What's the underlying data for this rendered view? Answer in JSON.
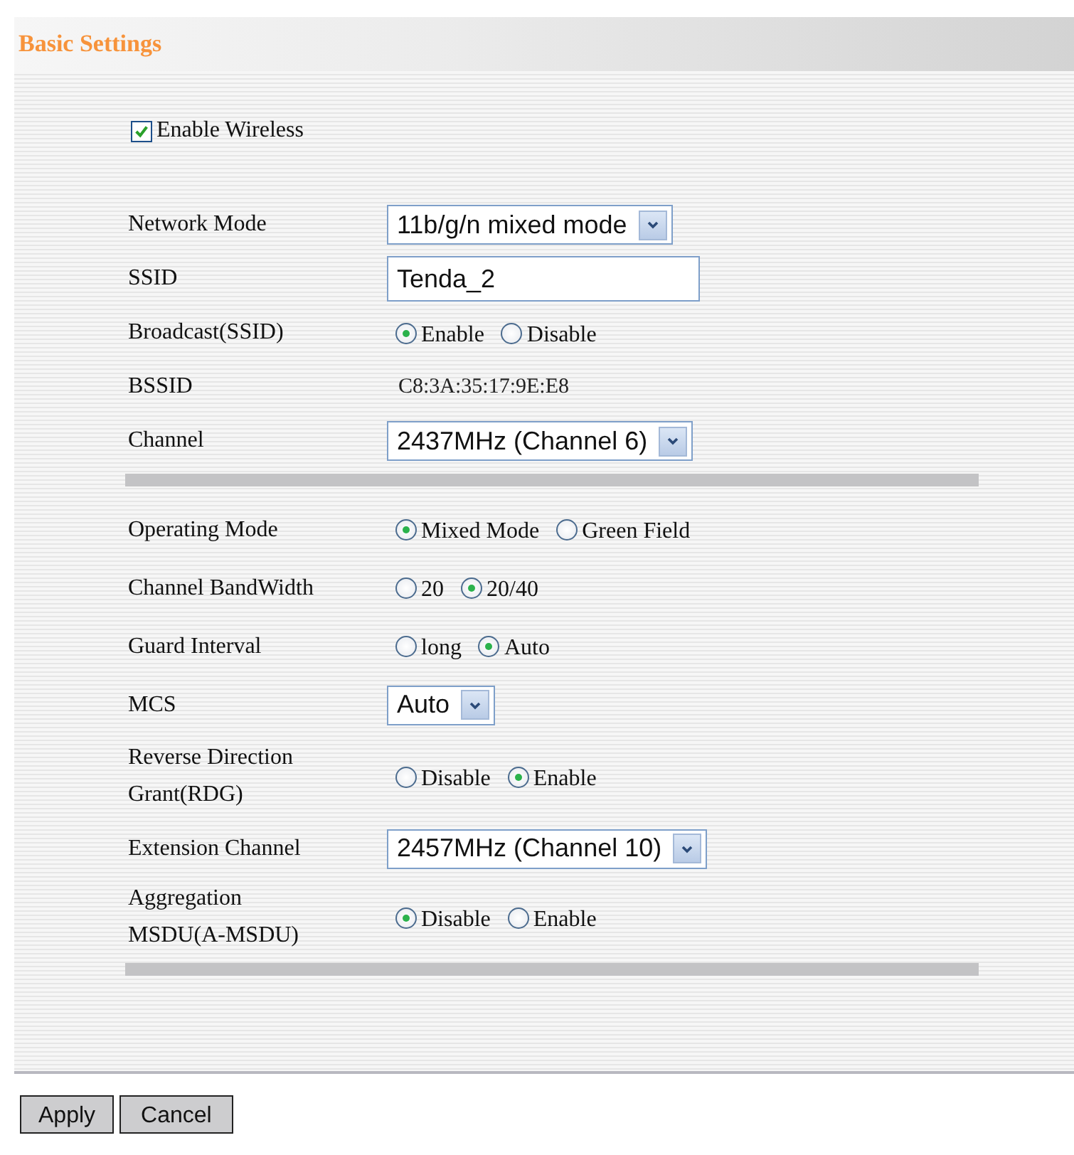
{
  "title": "Basic Settings",
  "enable_wireless": {
    "label": "Enable Wireless",
    "checked": true
  },
  "sections": [
    {
      "rows": [
        {
          "label": "Network Mode",
          "kind": "select",
          "value": "11b/g/n mixed mode"
        },
        {
          "label": "SSID",
          "kind": "input",
          "value": "Tenda_2"
        },
        {
          "label": "Broadcast(SSID)",
          "kind": "radio",
          "options": [
            {
              "label": "Enable",
              "selected": true
            },
            {
              "label": "Disable",
              "selected": false
            }
          ]
        },
        {
          "label": "BSSID",
          "kind": "static",
          "value": "C8:3A:35:17:9E:E8"
        },
        {
          "label": "Channel",
          "kind": "select",
          "value": "2437MHz (Channel 6)"
        }
      ]
    },
    {
      "rows": [
        {
          "label": "Operating Mode",
          "kind": "radio",
          "options": [
            {
              "label": "Mixed Mode",
              "selected": true
            },
            {
              "label": "Green Field",
              "selected": false
            }
          ]
        },
        {
          "label": "Channel BandWidth",
          "kind": "radio",
          "options": [
            {
              "label": "20",
              "selected": false
            },
            {
              "label": "20/40",
              "selected": true
            }
          ]
        },
        {
          "label": "Guard Interval",
          "kind": "radio",
          "options": [
            {
              "label": "long",
              "selected": false
            },
            {
              "label": "Auto",
              "selected": true
            }
          ]
        },
        {
          "label": "MCS",
          "kind": "select",
          "value": "Auto"
        },
        {
          "label": "Reverse Direction Grant(RDG)",
          "kind": "radio",
          "options": [
            {
              "label": "Disable",
              "selected": false
            },
            {
              "label": "Enable",
              "selected": true
            }
          ]
        },
        {
          "label": "Extension Channel",
          "kind": "select",
          "value": "2457MHz (Channel 10)"
        },
        {
          "label": "Aggregation MSDU(A-MSDU)",
          "kind": "radio",
          "options": [
            {
              "label": "Disable",
              "selected": true
            },
            {
              "label": "Enable",
              "selected": false
            }
          ]
        }
      ]
    }
  ],
  "buttons": [
    {
      "label": "Apply"
    },
    {
      "label": "Cancel"
    }
  ]
}
